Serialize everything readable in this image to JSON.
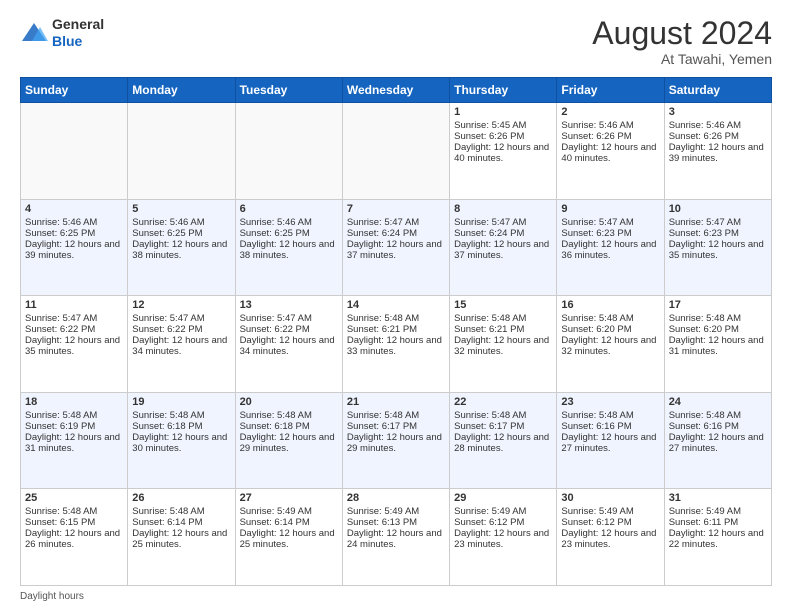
{
  "header": {
    "logo_line1": "General",
    "logo_line2": "Blue",
    "month_year": "August 2024",
    "location": "At Tawahi, Yemen"
  },
  "footer": {
    "daylight_label": "Daylight hours"
  },
  "days_of_week": [
    "Sunday",
    "Monday",
    "Tuesday",
    "Wednesday",
    "Thursday",
    "Friday",
    "Saturday"
  ],
  "weeks": [
    [
      {
        "day": "",
        "text": ""
      },
      {
        "day": "",
        "text": ""
      },
      {
        "day": "",
        "text": ""
      },
      {
        "day": "",
        "text": ""
      },
      {
        "day": "1",
        "text": "Sunrise: 5:45 AM\nSunset: 6:26 PM\nDaylight: 12 hours and 40 minutes."
      },
      {
        "day": "2",
        "text": "Sunrise: 5:46 AM\nSunset: 6:26 PM\nDaylight: 12 hours and 40 minutes."
      },
      {
        "day": "3",
        "text": "Sunrise: 5:46 AM\nSunset: 6:26 PM\nDaylight: 12 hours and 39 minutes."
      }
    ],
    [
      {
        "day": "4",
        "text": "Sunrise: 5:46 AM\nSunset: 6:25 PM\nDaylight: 12 hours and 39 minutes."
      },
      {
        "day": "5",
        "text": "Sunrise: 5:46 AM\nSunset: 6:25 PM\nDaylight: 12 hours and 38 minutes."
      },
      {
        "day": "6",
        "text": "Sunrise: 5:46 AM\nSunset: 6:25 PM\nDaylight: 12 hours and 38 minutes."
      },
      {
        "day": "7",
        "text": "Sunrise: 5:47 AM\nSunset: 6:24 PM\nDaylight: 12 hours and 37 minutes."
      },
      {
        "day": "8",
        "text": "Sunrise: 5:47 AM\nSunset: 6:24 PM\nDaylight: 12 hours and 37 minutes."
      },
      {
        "day": "9",
        "text": "Sunrise: 5:47 AM\nSunset: 6:23 PM\nDaylight: 12 hours and 36 minutes."
      },
      {
        "day": "10",
        "text": "Sunrise: 5:47 AM\nSunset: 6:23 PM\nDaylight: 12 hours and 35 minutes."
      }
    ],
    [
      {
        "day": "11",
        "text": "Sunrise: 5:47 AM\nSunset: 6:22 PM\nDaylight: 12 hours and 35 minutes."
      },
      {
        "day": "12",
        "text": "Sunrise: 5:47 AM\nSunset: 6:22 PM\nDaylight: 12 hours and 34 minutes."
      },
      {
        "day": "13",
        "text": "Sunrise: 5:47 AM\nSunset: 6:22 PM\nDaylight: 12 hours and 34 minutes."
      },
      {
        "day": "14",
        "text": "Sunrise: 5:48 AM\nSunset: 6:21 PM\nDaylight: 12 hours and 33 minutes."
      },
      {
        "day": "15",
        "text": "Sunrise: 5:48 AM\nSunset: 6:21 PM\nDaylight: 12 hours and 32 minutes."
      },
      {
        "day": "16",
        "text": "Sunrise: 5:48 AM\nSunset: 6:20 PM\nDaylight: 12 hours and 32 minutes."
      },
      {
        "day": "17",
        "text": "Sunrise: 5:48 AM\nSunset: 6:20 PM\nDaylight: 12 hours and 31 minutes."
      }
    ],
    [
      {
        "day": "18",
        "text": "Sunrise: 5:48 AM\nSunset: 6:19 PM\nDaylight: 12 hours and 31 minutes."
      },
      {
        "day": "19",
        "text": "Sunrise: 5:48 AM\nSunset: 6:18 PM\nDaylight: 12 hours and 30 minutes."
      },
      {
        "day": "20",
        "text": "Sunrise: 5:48 AM\nSunset: 6:18 PM\nDaylight: 12 hours and 29 minutes."
      },
      {
        "day": "21",
        "text": "Sunrise: 5:48 AM\nSunset: 6:17 PM\nDaylight: 12 hours and 29 minutes."
      },
      {
        "day": "22",
        "text": "Sunrise: 5:48 AM\nSunset: 6:17 PM\nDaylight: 12 hours and 28 minutes."
      },
      {
        "day": "23",
        "text": "Sunrise: 5:48 AM\nSunset: 6:16 PM\nDaylight: 12 hours and 27 minutes."
      },
      {
        "day": "24",
        "text": "Sunrise: 5:48 AM\nSunset: 6:16 PM\nDaylight: 12 hours and 27 minutes."
      }
    ],
    [
      {
        "day": "25",
        "text": "Sunrise: 5:48 AM\nSunset: 6:15 PM\nDaylight: 12 hours and 26 minutes."
      },
      {
        "day": "26",
        "text": "Sunrise: 5:48 AM\nSunset: 6:14 PM\nDaylight: 12 hours and 25 minutes."
      },
      {
        "day": "27",
        "text": "Sunrise: 5:49 AM\nSunset: 6:14 PM\nDaylight: 12 hours and 25 minutes."
      },
      {
        "day": "28",
        "text": "Sunrise: 5:49 AM\nSunset: 6:13 PM\nDaylight: 12 hours and 24 minutes."
      },
      {
        "day": "29",
        "text": "Sunrise: 5:49 AM\nSunset: 6:12 PM\nDaylight: 12 hours and 23 minutes."
      },
      {
        "day": "30",
        "text": "Sunrise: 5:49 AM\nSunset: 6:12 PM\nDaylight: 12 hours and 23 minutes."
      },
      {
        "day": "31",
        "text": "Sunrise: 5:49 AM\nSunset: 6:11 PM\nDaylight: 12 hours and 22 minutes."
      }
    ]
  ]
}
